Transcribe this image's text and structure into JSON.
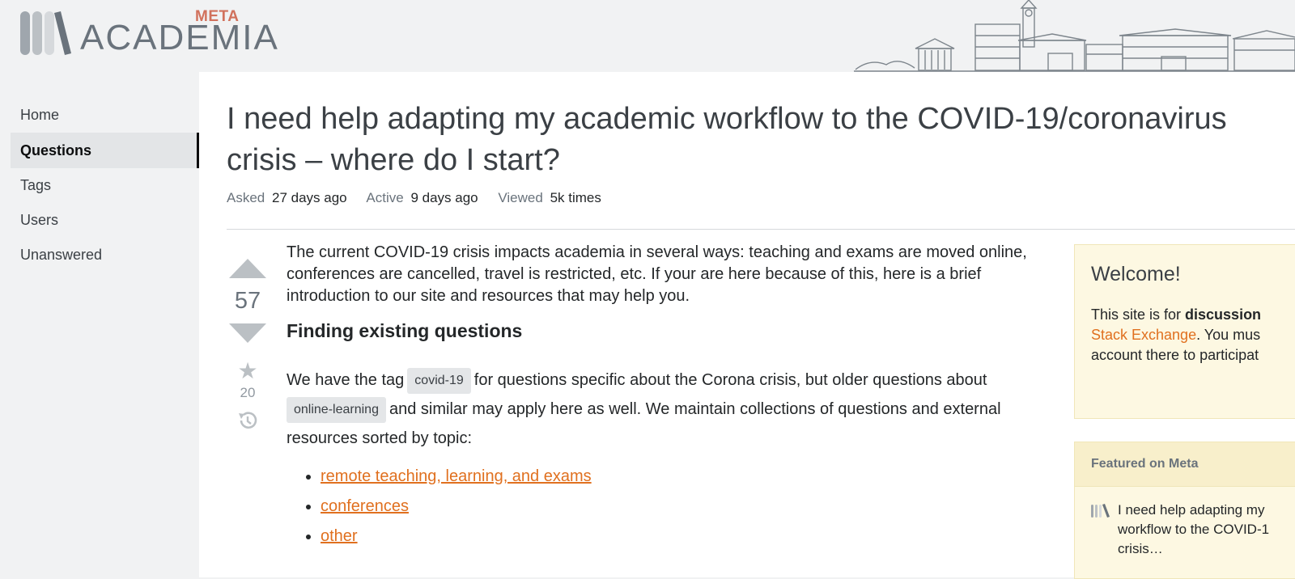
{
  "site": {
    "logo_meta": "META",
    "logo_name": "ACADEMIA"
  },
  "sidebar": {
    "items": [
      {
        "label": "Home",
        "active": false
      },
      {
        "label": "Questions",
        "active": true
      },
      {
        "label": "Tags",
        "active": false
      },
      {
        "label": "Users",
        "active": false
      },
      {
        "label": "Unanswered",
        "active": false
      }
    ]
  },
  "question": {
    "title": "I need help adapting my academic workflow to the COVID-19/coronavirus crisis – where do I start?",
    "asked_label": "Asked",
    "asked_value": "27 days ago",
    "active_label": "Active",
    "active_value": "9 days ago",
    "viewed_label": "Viewed",
    "viewed_value": "5k times",
    "vote_count": "57",
    "favorite_count": "20"
  },
  "post": {
    "intro": "The current COVID-19 crisis impacts academia in several ways: teaching and exams are moved online, conferences are cancelled, travel is restricted, etc. If your are here because of this, here is a brief introduction to our site and resources that may help you.",
    "heading": "Finding existing questions",
    "tag_text_1": "We have the tag",
    "tag_1": "covid-19",
    "tag_text_2": "for questions specific about the Corona crisis, but older questions about",
    "tag_2": "online-learning",
    "tag_text_3": "and similar may apply here as well. We maintain collections of questions and external resources sorted by topic:",
    "links": [
      "remote teaching, learning, and exams",
      "conferences",
      "other"
    ]
  },
  "welcome": {
    "title": "Welcome!",
    "line1_prefix": "This site is for ",
    "line1_bold": "discussion",
    "line2_link": "Stack Exchange",
    "line2_rest": ". You mus",
    "line3": "account there to participat"
  },
  "featured": {
    "header": "Featured on Meta",
    "item": "I need help adapting my\nworkflow to the COVID-1\ncrisis…"
  },
  "colors": {
    "accent_orange": "#e0701f",
    "meta_red": "#d1715c",
    "notice_bg": "#fdf8e2"
  }
}
